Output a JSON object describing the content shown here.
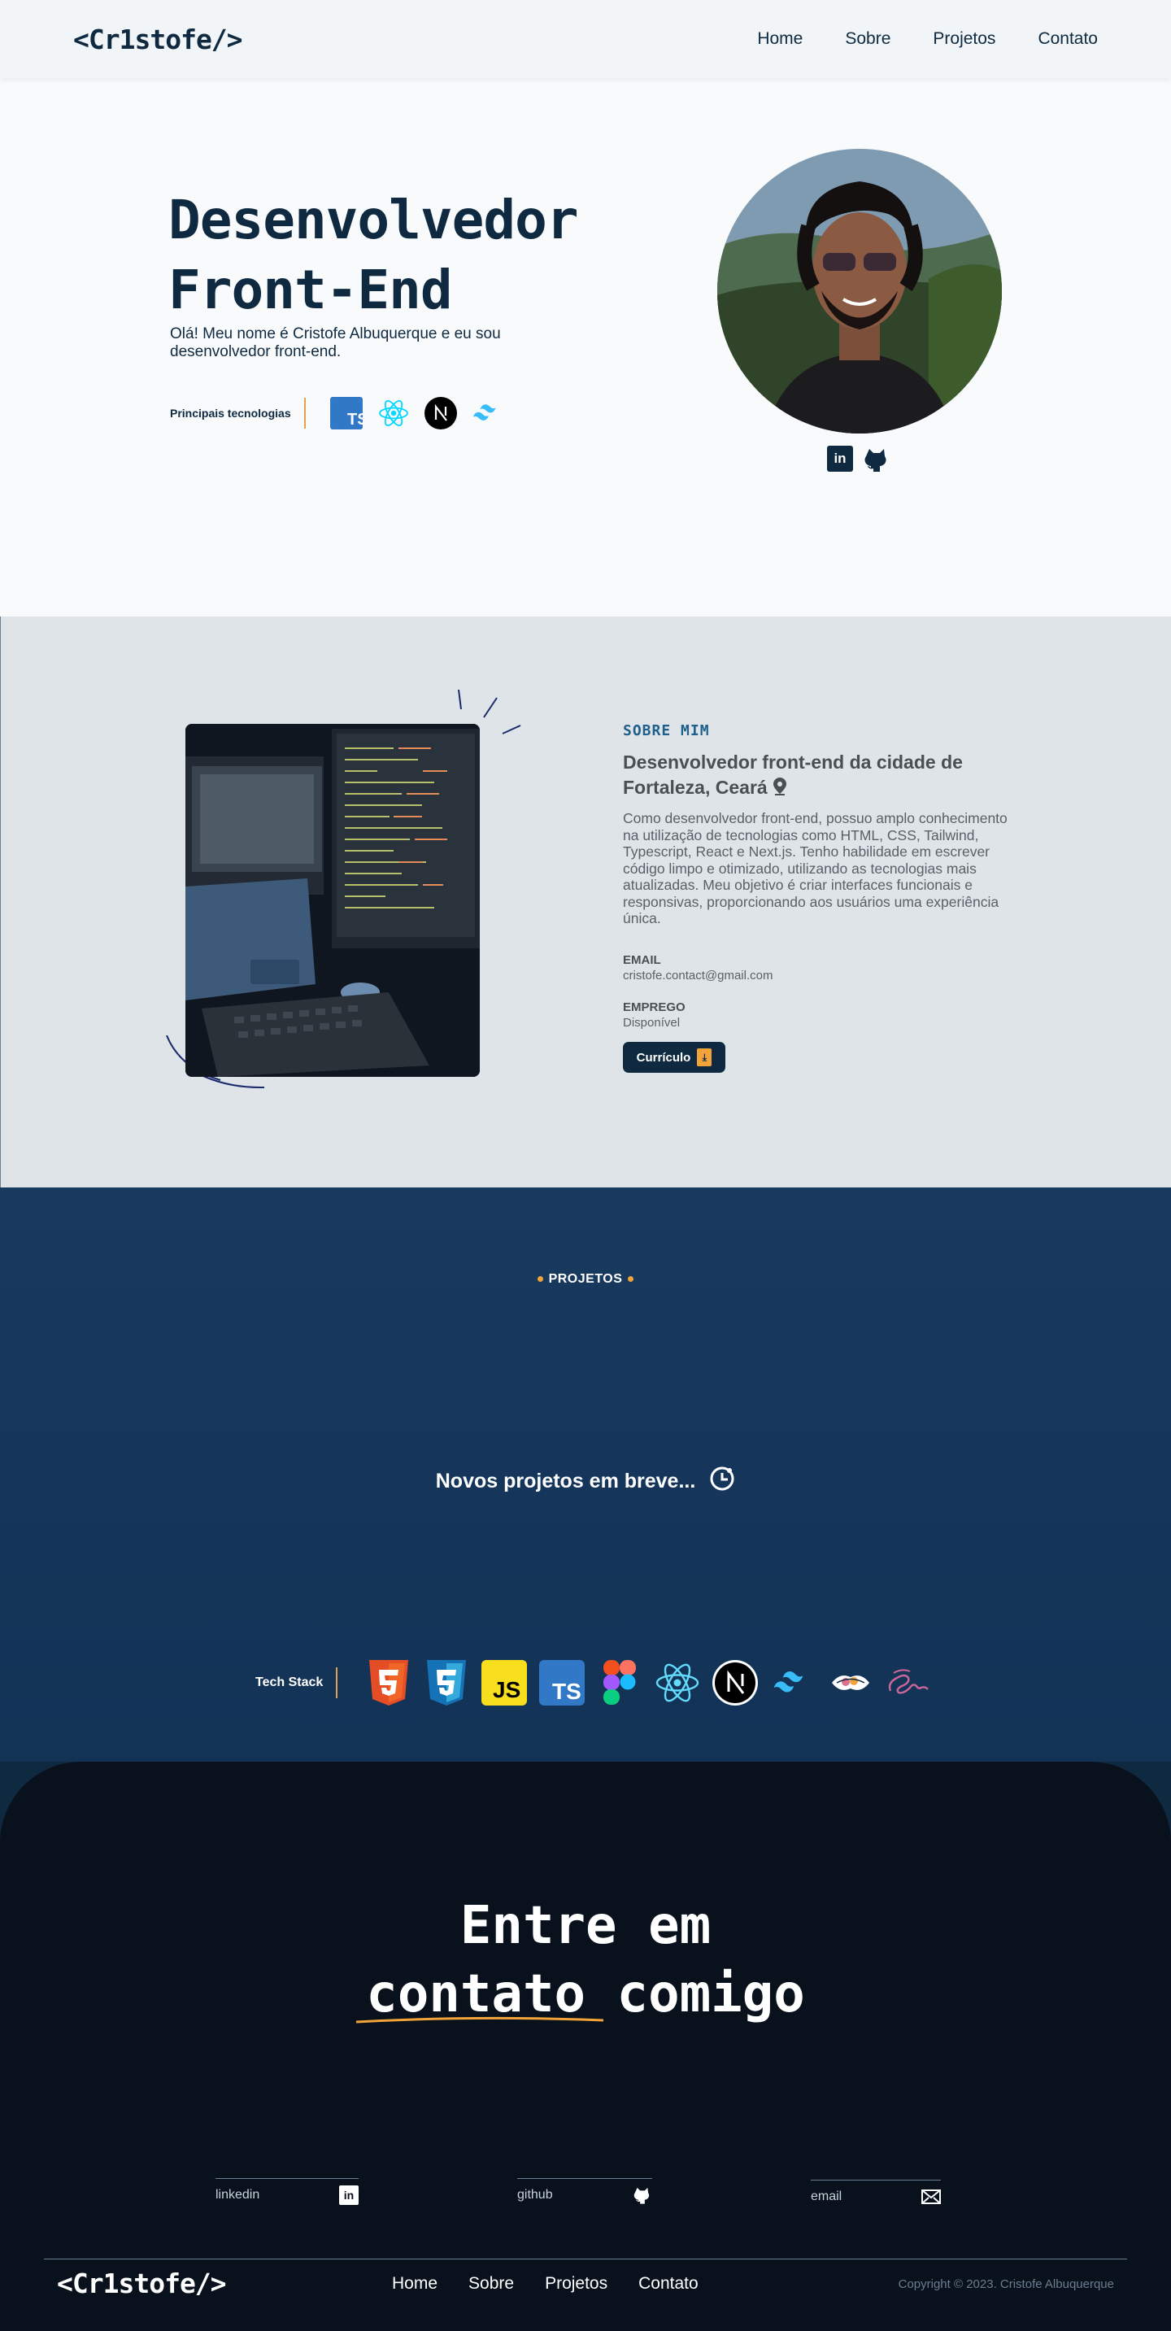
{
  "header": {
    "logo": "<Cr1stofe/>",
    "nav": [
      "Home",
      "Sobre",
      "Projetos",
      "Contato"
    ]
  },
  "hero": {
    "title_line1": "Desenvolvedor",
    "title_line2": "Front-End",
    "intro": "Olá! Meu nome é Cristofe Albuquerque e eu sou desenvolvedor front-end.",
    "tech_label": "Principais tecnologias",
    "tech_icons": [
      "typescript-icon",
      "react-icon",
      "nextjs-icon",
      "tailwind-icon"
    ],
    "socials": [
      "linkedin-icon",
      "github-icon"
    ]
  },
  "about": {
    "tag": "SOBRE MIM",
    "heading": "Desenvolvedor front-end da cidade de Fortaleza, Ceará",
    "description": "Como desenvolvedor front-end, possuo amplo conhecimento na utilização de tecnologias como HTML, CSS, Tailwind, Typescript, React e Next.js. Tenho habilidade em escrever código limpo e otimizado, utilizando as tecnologias mais atualizadas. Meu objetivo é criar interfaces funcionais e responsivas, proporcionando aos usuários uma experiência única.",
    "email_label": "EMAIL",
    "email_value": "cristofe.contact@gmail.com",
    "job_label": "EMPREGO",
    "job_value": "Disponível",
    "cv_label": "Currículo"
  },
  "projects": {
    "title": "PROJETOS",
    "coming_soon": "Novos projetos em breve...",
    "stack_label": "Tech Stack",
    "stack_icons": [
      "html5-icon",
      "css3-icon",
      "javascript-icon",
      "typescript-icon",
      "figma-icon",
      "react-icon",
      "nextjs-icon",
      "tailwind-icon",
      "styled-components-icon",
      "sass-icon"
    ]
  },
  "contact": {
    "title_line1": "Entre em",
    "title_word_underlined": "contato",
    "title_word_rest": "comigo",
    "links": [
      {
        "label": "linkedin"
      },
      {
        "label": "github"
      },
      {
        "label": "email"
      }
    ]
  },
  "footer": {
    "logo": "<Cr1stofe/>",
    "nav": [
      "Home",
      "Sobre",
      "Projetos",
      "Contato"
    ],
    "copyright": "Copyright © 2023. Cristofe Albuquerque"
  },
  "colors": {
    "navy": "#0f2a40",
    "accent": "#f2a43a",
    "projects_bg": "#183a5e",
    "contact_bg": "#08111c"
  }
}
